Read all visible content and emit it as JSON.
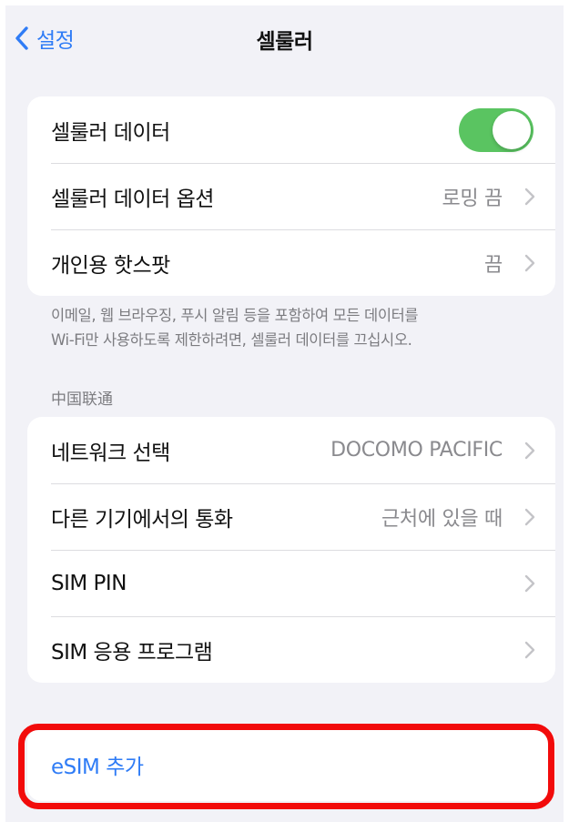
{
  "nav": {
    "back_label": "설정",
    "title": "셀룰러"
  },
  "cellular_group": {
    "cellular_data": {
      "label": "셀룰러 데이터",
      "toggle_on": true
    },
    "data_options": {
      "label": "셀룰러 데이터 옵션",
      "value": "로밍 끔"
    },
    "hotspot": {
      "label": "개인용 핫스팟",
      "value": "끔"
    }
  },
  "footnote": {
    "line1": "이메일, 웹 브라우징, 푸시 알림 등을 포함하여 모든 데이터를",
    "line2": "Wi-Fi만 사용하도록 제한하려면, 셀룰러 데이터를 끄십시오."
  },
  "carrier_section": {
    "header": "中国联通",
    "rows": [
      {
        "label": "네트워크 선택",
        "value": "DOCOMO PACIFIC"
      },
      {
        "label": "다른 기기에서의 통화",
        "value": "근처에 있을 때"
      },
      {
        "label": "SIM PIN",
        "value": ""
      },
      {
        "label": "SIM 응용 프로그램",
        "value": ""
      }
    ]
  },
  "esim": {
    "label": "eSIM 추가"
  },
  "colors": {
    "accent": "#2f7cf6",
    "toggle_on": "#5ac461",
    "highlight": "#f20b0b",
    "background": "#f2f2f7"
  },
  "icons": {
    "back": "chevron-left-icon",
    "disclosure": "chevron-right-icon"
  }
}
